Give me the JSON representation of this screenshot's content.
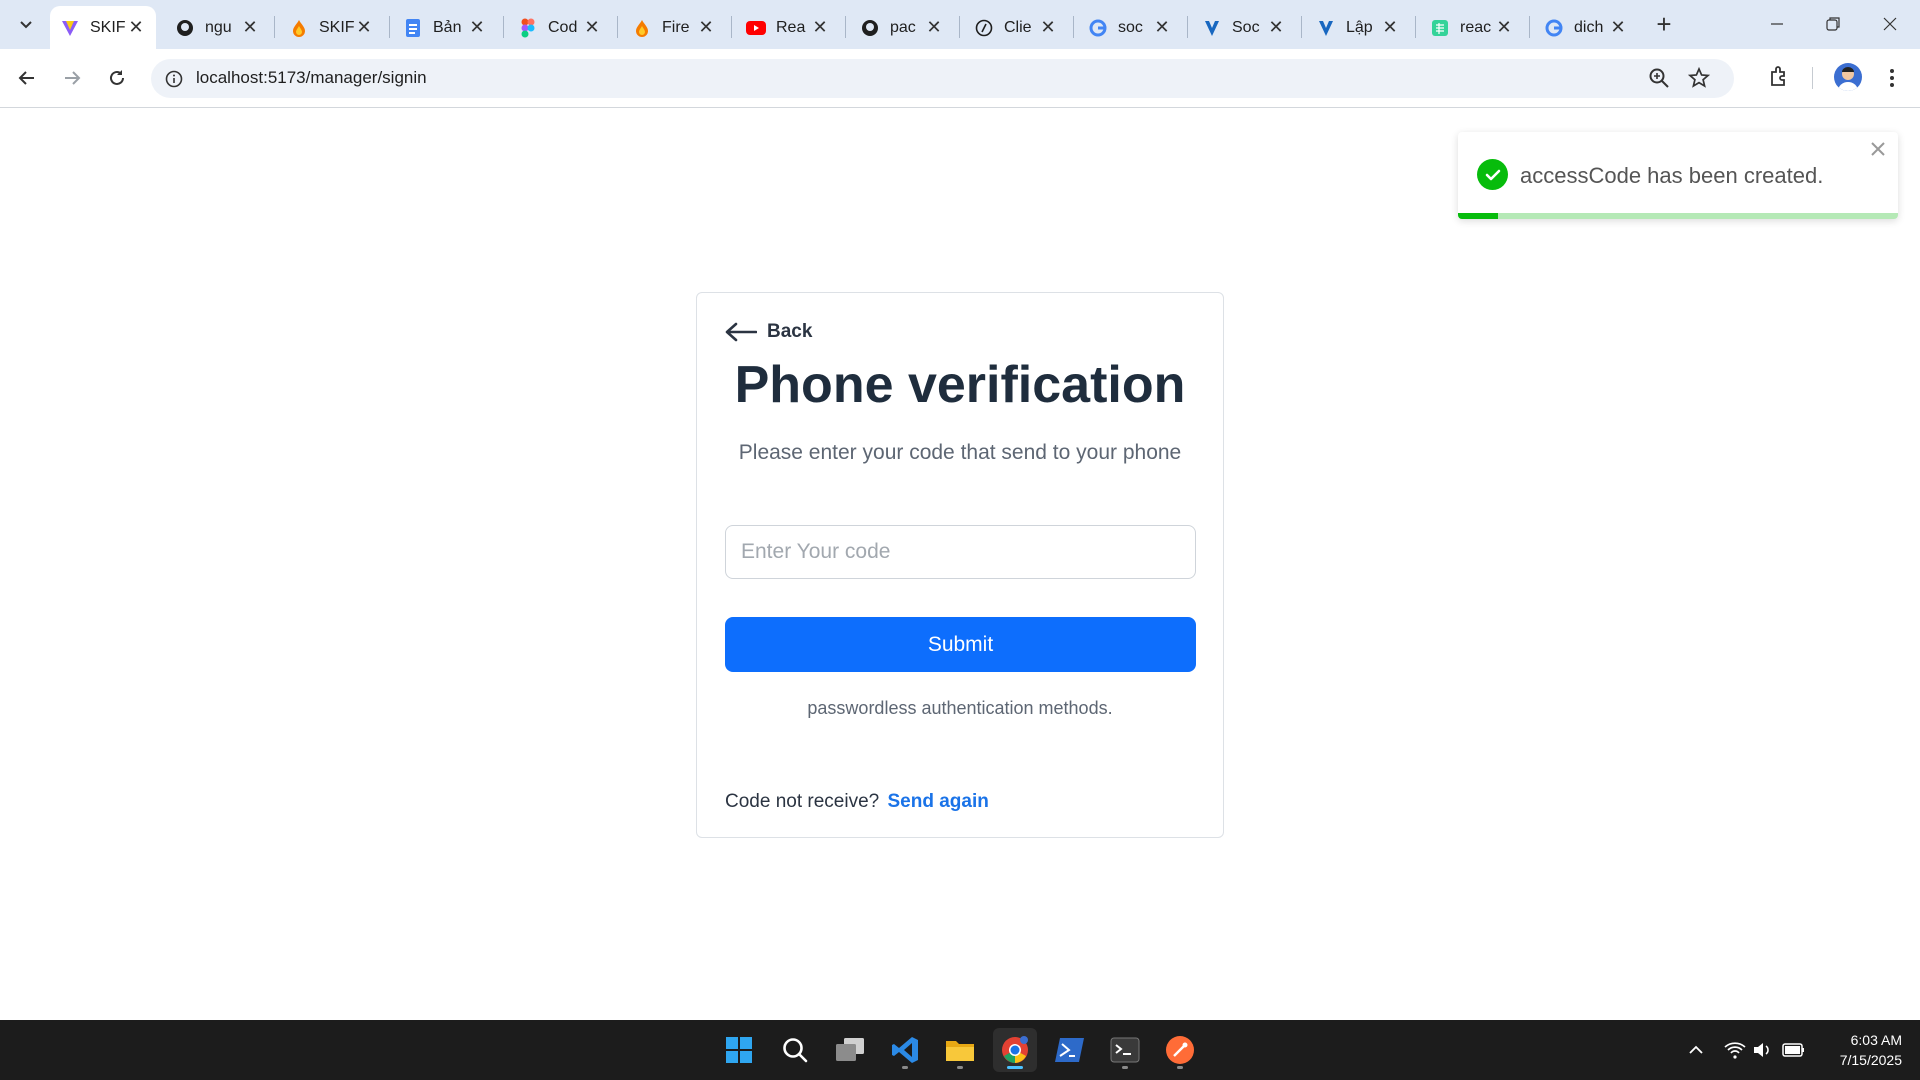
{
  "browser": {
    "tabs": [
      {
        "title": "SKIF",
        "active": true,
        "icon": "vite-icon"
      },
      {
        "title": "ngu",
        "icon": "github-icon"
      },
      {
        "title": "SKIF",
        "icon": "firebase-icon"
      },
      {
        "title": "Bản",
        "icon": "google-docs-icon"
      },
      {
        "title": "Cod",
        "icon": "figma-icon"
      },
      {
        "title": "Fire",
        "icon": "firebase-icon"
      },
      {
        "title": "Rea",
        "icon": "youtube-icon"
      },
      {
        "title": "pac",
        "icon": "github-icon"
      },
      {
        "title": "Clie",
        "icon": "compass-icon"
      },
      {
        "title": "soc",
        "icon": "google-icon"
      },
      {
        "title": "Soc",
        "icon": "vuetify-icon"
      },
      {
        "title": "Lập",
        "icon": "vuetify-icon"
      },
      {
        "title": "reac",
        "icon": "sheets-icon"
      },
      {
        "title": "dich",
        "icon": "google-icon"
      }
    ],
    "url": "localhost:5173/manager/signin"
  },
  "page": {
    "back_label": "Back",
    "title": "Phone verification",
    "subtitle": "Please enter your code that send to your phone",
    "code_input": {
      "placeholder": "Enter Your code",
      "value": ""
    },
    "submit_label": "Submit",
    "methods_text": "passwordless authentication methods.",
    "resend_prompt": "Code not receive?",
    "resend_link": "Send again"
  },
  "toast": {
    "message": "accessCode has been created.",
    "type": "success",
    "progress_remaining_fraction": 0.09
  },
  "taskbar": {
    "apps": [
      "windows-start-icon",
      "search-icon",
      "task-view-icon",
      "vscode-icon",
      "file-explorer-icon",
      "chrome-icon",
      "powershell-icon",
      "terminal-icon",
      "postman-icon"
    ],
    "time": "6:03 AM",
    "date": "7/15/2025"
  },
  "colors": {
    "primary": "#0d6efd",
    "link": "#1a73e8",
    "success": "#07bc0c",
    "heading": "#1f2d3d"
  }
}
